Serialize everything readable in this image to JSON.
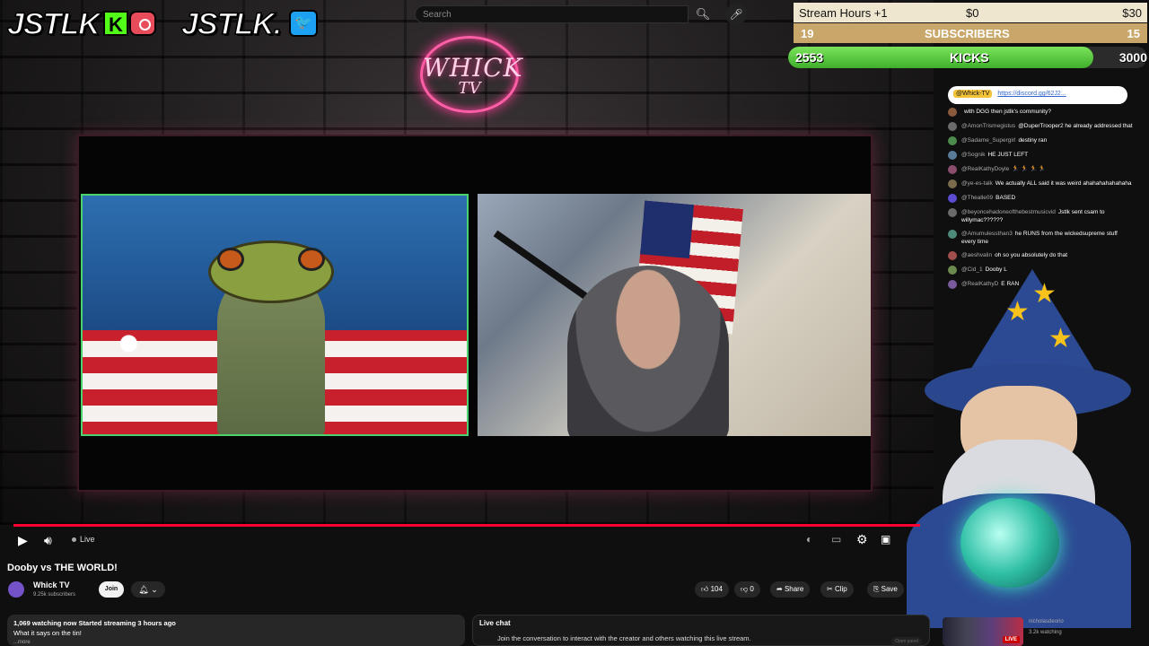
{
  "overlay": {
    "logo_left_text": "JSTLK",
    "logo_kick": "K",
    "logo_right_text": "JSTLK.",
    "neon_line1": "WHICK",
    "neon_line2": "TV",
    "goal_stream_hours_label": "Stream Hours +1",
    "goal_stream_hours_current": "$0",
    "goal_stream_hours_target": "$30",
    "goal_subs_current": "19",
    "goal_subs_label": "SUBSCRIBERS",
    "goal_subs_target": "15",
    "goal_kicks_current": "2553",
    "goal_kicks_label": "KICKS",
    "goal_kicks_target": "3000",
    "goal_kicks_progress": 0.851
  },
  "search": {
    "placeholder": "Search"
  },
  "player": {
    "live_label": "Live",
    "play_icon": "play-icon",
    "volume_icon": "volume-icon"
  },
  "chat": {
    "pinned_tag": "@Whick-TV",
    "pinned_url": "https://discord.gg/62J2...",
    "messages": [
      {
        "user": "",
        "text": "with DGG then jstlk's community?"
      },
      {
        "user": "@AmonTrismegistus",
        "text": "@DuperTrooper2 he already addressed that"
      },
      {
        "user": "@Sadame_Supergirl",
        "text": "destiny ran"
      },
      {
        "user": "@Sognik",
        "text": "HE JUST LEFT"
      },
      {
        "user": "@RealKathyDoyle",
        "text": "🏃 🏃 🏃 🏃"
      },
      {
        "user": "@ye-es-talk",
        "text": "We actually ALL said it was weird ahahahahahahaha"
      },
      {
        "user": "@Thealle09",
        "text": "BASED"
      },
      {
        "user": "@beyoncehadoneofthebestmusicvid",
        "text": "Jstlk sent csam to willymac??????"
      },
      {
        "user": "@Amumulessthan3",
        "text": "he RUNS from the wickedsupreme stuff every time"
      },
      {
        "user": "@aeshvalin",
        "text": "oh so you absolutely do that"
      },
      {
        "user": "@Cid_1",
        "text": "Dooby L"
      },
      {
        "user": "@RealKathyD",
        "text": "E RAN"
      }
    ]
  },
  "video": {
    "title": "Dooby vs THE WORLD!",
    "channel_name": "Whick TV",
    "channel_subs": "9.25k subscribers",
    "join_label": "Join",
    "likes": "104",
    "dislikes": "0",
    "share_label": "Share",
    "clip_label": "Clip",
    "save_label": "Save"
  },
  "description": {
    "meta": "1,069 watching now  Started streaming 3 hours ago",
    "text": "What it says on the tin!",
    "more": "...more"
  },
  "live_chat": {
    "header": "Live chat",
    "join_text": "Join the conversation to interact with the creator and others watching this live stream.",
    "open_panel": "Open panel"
  },
  "recommend": {
    "live_badge": "LIVE",
    "channel": "nicholasdeorio",
    "watching": "3.2k watching"
  },
  "colors": {
    "progress": "#ff0033",
    "kicks_green": "#3faf2b",
    "subs_gold": "#c9a76a",
    "neon_pink": "#ff5fa7"
  }
}
